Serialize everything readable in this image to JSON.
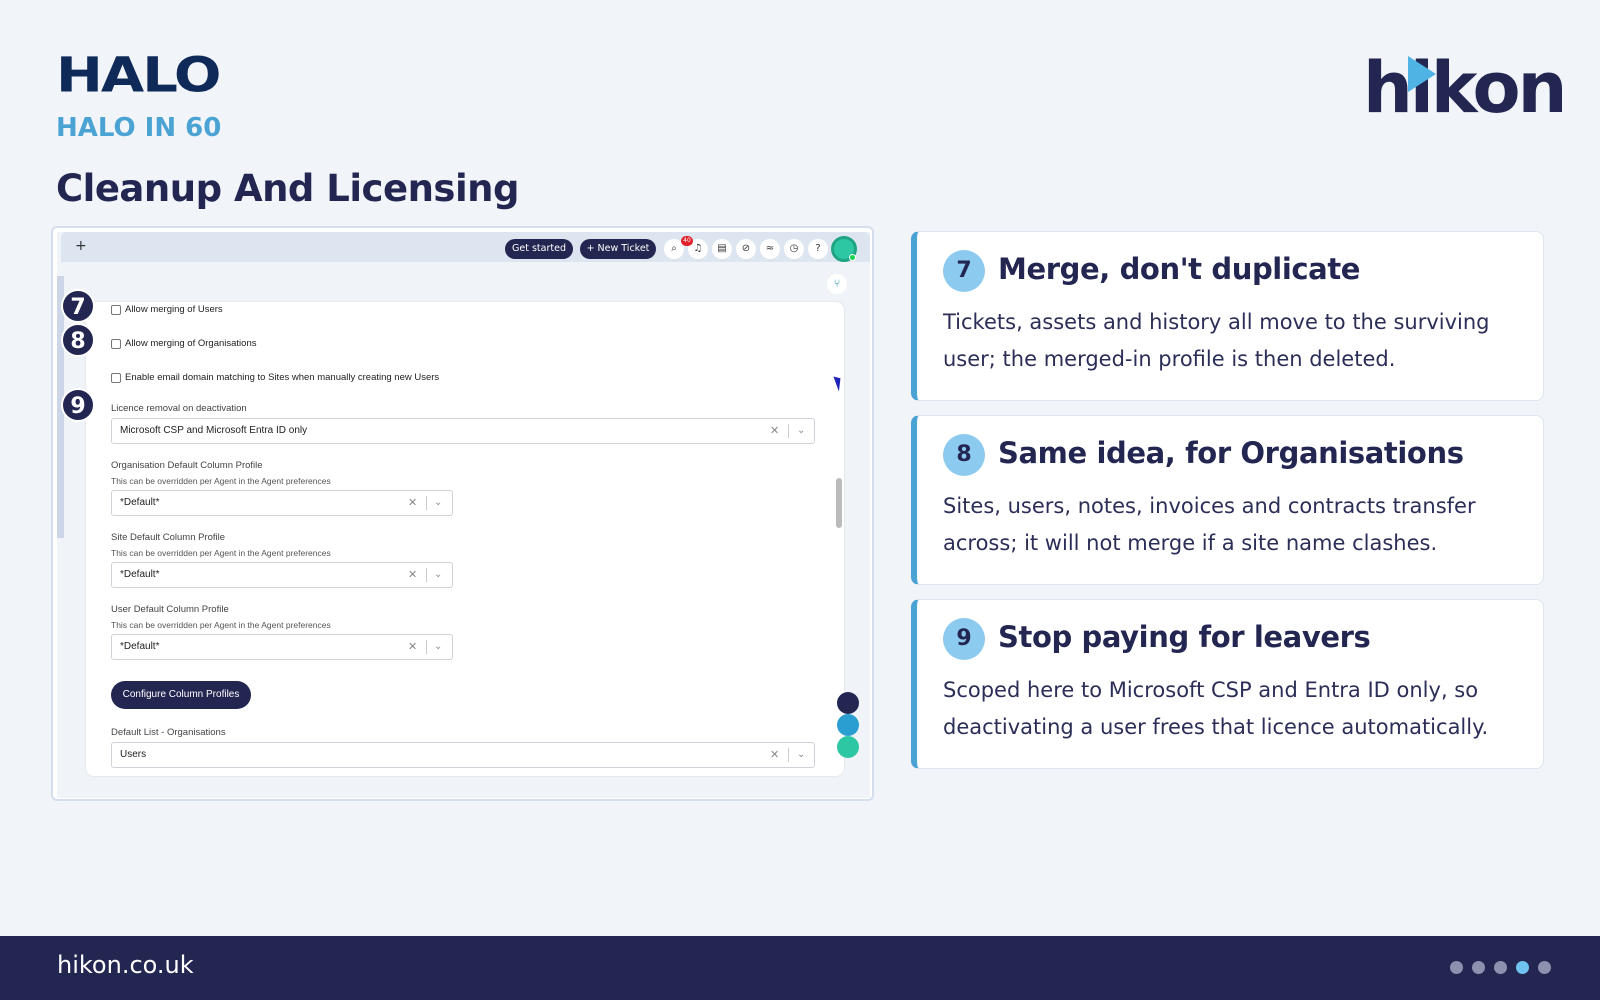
{
  "header": {
    "logo_text": "HALO",
    "series": "HALO IN 60",
    "title": "Cleanup And Licensing",
    "partner_logo": "hikon"
  },
  "app": {
    "topbar": {
      "plus": "+",
      "get_started": "Get started",
      "new_ticket": "+ New Ticket",
      "notification_count": "40",
      "icons": [
        "search-icon",
        "bell-icon",
        "clipboard-icon",
        "compass-icon",
        "feed-icon",
        "clock-icon",
        "help-icon"
      ],
      "icon_glyphs": [
        "⌕",
        "♫",
        "▤",
        "⊘",
        "≈",
        "◷",
        "?"
      ]
    },
    "branch_glyph": "⑂",
    "checkboxes": [
      {
        "label": "Allow merging of Users",
        "checked": false
      },
      {
        "label": "Allow merging of Organisations",
        "checked": false
      },
      {
        "label": "Enable email domain matching to Sites when manually creating new Users",
        "checked": false
      }
    ],
    "markers": [
      "7",
      "8",
      "9"
    ],
    "licence_field": {
      "label": "Licence removal on deactivation",
      "value": "Microsoft CSP and Microsoft Entra ID only"
    },
    "org_profile": {
      "label": "Organisation Default Column Profile",
      "hint": "This can be overridden per Agent in the Agent preferences",
      "value": "*Default*"
    },
    "site_profile": {
      "label": "Site Default Column Profile",
      "hint": "This can be overridden per Agent in the Agent preferences",
      "value": "*Default*"
    },
    "user_profile": {
      "label": "User Default Column Profile",
      "hint": "This can be overridden per Agent in the Agent preferences",
      "value": "*Default*"
    },
    "configure_button": "Configure Column Profiles",
    "default_list": {
      "label": "Default List - Organisations",
      "value": "Users"
    },
    "clear_glyph": "✕",
    "chevron_glyph": "⌄"
  },
  "cards": [
    {
      "num": "7",
      "title": "Merge, don't duplicate",
      "body": "Tickets, assets and history all move to the surviving user; the merged-in profile is then deleted."
    },
    {
      "num": "8",
      "title": "Same idea, for Organisations",
      "body": "Sites, users, notes, invoices and contracts transfer across; it will not merge if a site name clashes."
    },
    {
      "num": "9",
      "title": "Stop paying for leavers",
      "body": "Scoped here to Microsoft CSP and Entra ID only, so deactivating a user frees that licence automatically."
    }
  ],
  "footer": {
    "site": "hikon.co.uk",
    "pagination": {
      "total": 5,
      "active_index": 3
    }
  },
  "colors": {
    "navy": "#232651",
    "accent": "#4ba3d4",
    "badge": "#e1222b"
  }
}
